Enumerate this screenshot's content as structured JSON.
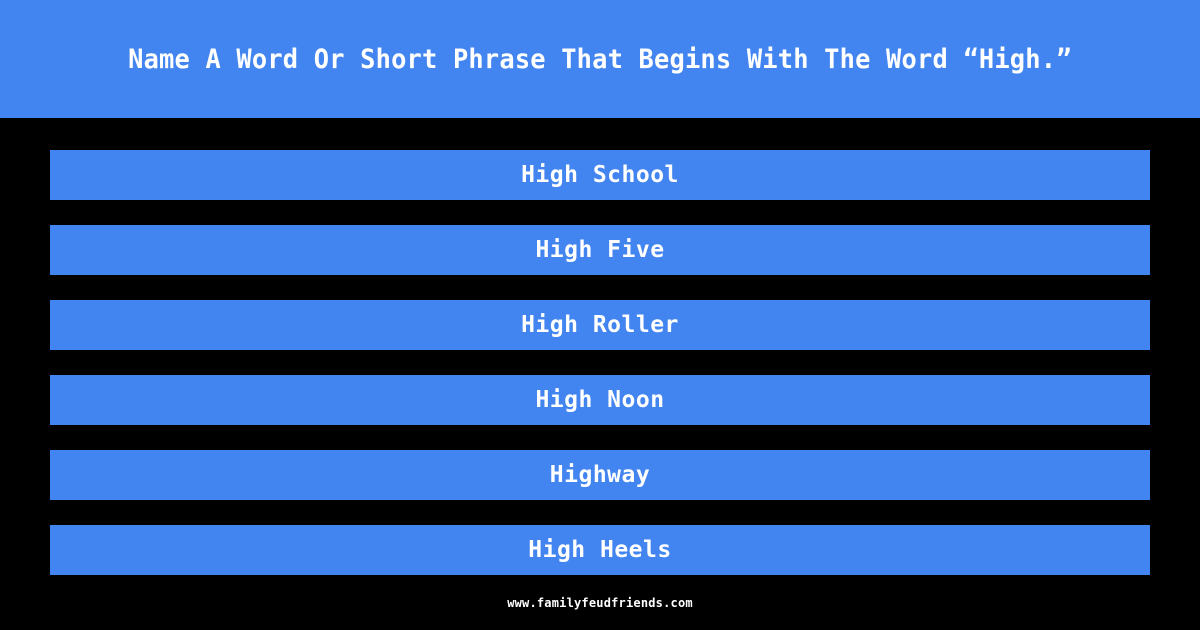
{
  "header": {
    "question": "Name A Word Or Short Phrase That Begins With The Word “High.”",
    "background_color": "#4285f0",
    "text_color": "#ffffff"
  },
  "board": {
    "background_color": "#000000",
    "answer_bar_color": "#4285f0",
    "answer_text_color": "#ffffff",
    "answers": [
      {
        "text": "High School"
      },
      {
        "text": "High Five"
      },
      {
        "text": "High Roller"
      },
      {
        "text": "High Noon"
      },
      {
        "text": "Highway"
      },
      {
        "text": "High Heels"
      }
    ]
  },
  "footer": {
    "site": "www.familyfeudfriends.com",
    "text_color": "#ffffff"
  }
}
